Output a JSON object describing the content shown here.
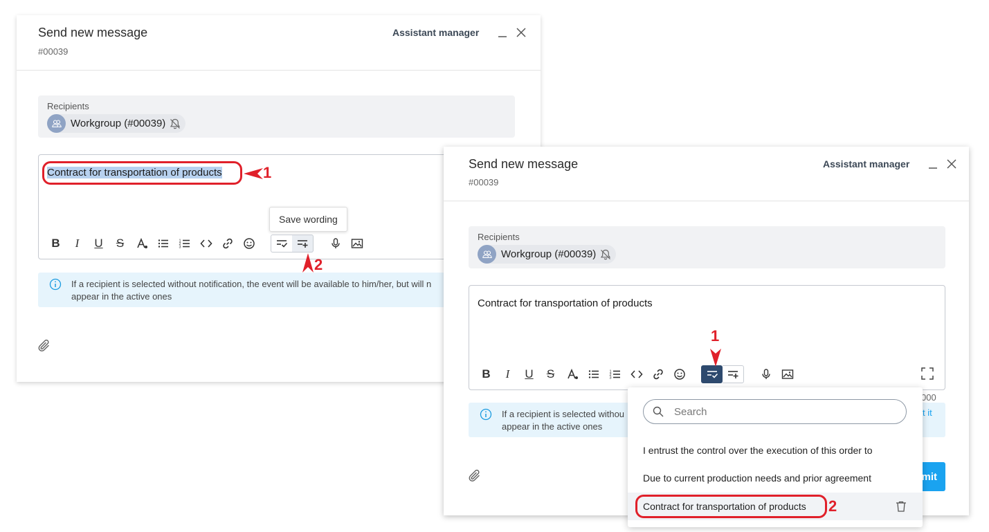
{
  "panel_back": {
    "title": "Send new message",
    "id": "#00039",
    "role": "Assistant manager",
    "recipients_label": "Recipients",
    "recipient_chip": "Workgroup (#00039)",
    "editor_text": "Contract for transportation of products",
    "tooltip": "Save wording",
    "info_line1": "If a recipient is selected without notification, the event will be available to him/her, but will n",
    "info_line2": "appear in the active ones",
    "markers": [
      "1",
      "2"
    ]
  },
  "panel_front": {
    "title": "Send new message",
    "id": "#00039",
    "role": "Assistant manager",
    "recipients_label": "Recipients",
    "recipient_chip": "Workgroup (#00039)",
    "editor_text": "Contract for transportation of products",
    "char_count_fragment": "000",
    "info_line1": "If a recipient is selected withou",
    "info_line1_tail": "t it",
    "info_line2": "appear in the active ones",
    "submit_fragment": "mit",
    "markers": [
      "1",
      "2"
    ]
  },
  "toolbar": {
    "bold": "B",
    "italic": "I",
    "underline": "U",
    "strike": "S"
  },
  "dropdown": {
    "search_placeholder": "Search",
    "items": [
      "I entrust the control over the execution of this order to",
      "Due to current production needs and prior agreement",
      "Contract for transportation of products"
    ]
  },
  "colors": {
    "accent": "#1aa3f0",
    "marker": "#e0202a",
    "active_button": "#2e4a6e",
    "info_bg": "#e6f4fc"
  }
}
